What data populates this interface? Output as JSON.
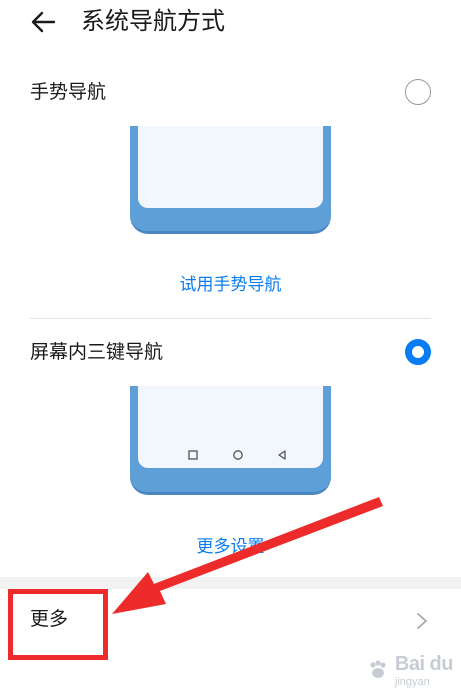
{
  "header": {
    "back_icon": "arrow-left-icon",
    "title": "系统导航方式"
  },
  "options": [
    {
      "label": "手势导航",
      "selected": false,
      "link": "试用手势导航"
    },
    {
      "label": "屏幕内三键导航",
      "selected": true,
      "link": "更多设置",
      "nav_keys": [
        "square-icon",
        "circle-icon",
        "triangle-back-icon"
      ]
    }
  ],
  "more": {
    "label": "更多",
    "chevron_icon": "chevron-right-icon"
  },
  "annotation": {
    "color": "#ee2b2b",
    "type": "arrow-pointing-to-more"
  },
  "watermark": {
    "logo": "Bai du",
    "sub": "jingyan"
  },
  "colors": {
    "accent": "#0a7cf2",
    "phone_frame": "#5d9fd6",
    "phone_screen": "#f1f7fc",
    "annotation_red": "#ee2b2b"
  }
}
